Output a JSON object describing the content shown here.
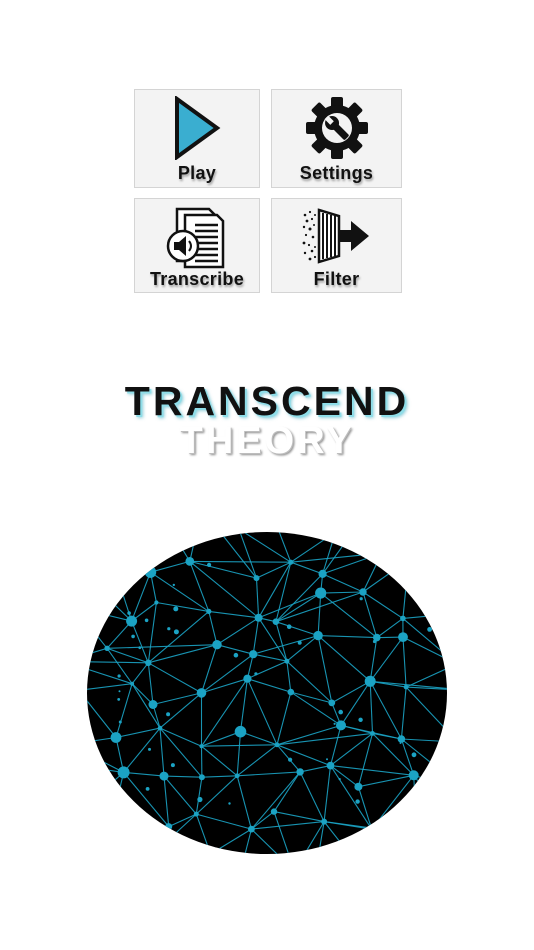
{
  "menu": {
    "play_label": "Play",
    "settings_label": "Settings",
    "transcribe_label": "Transcribe",
    "filter_label": "Filter"
  },
  "logo": {
    "line1": "TRANSCEND",
    "line2": "THEORY"
  },
  "icons": {
    "play": "play-icon",
    "settings": "gear-wrench-icon",
    "transcribe": "audio-document-icon",
    "filter": "filter-arrow-icon",
    "hero": "network-graph-icon"
  },
  "colors": {
    "play_triangle": "#3aaed0",
    "network_lines": "#1ba3c4",
    "orb_background": "#000000",
    "tile_background": "#f3f3f3"
  }
}
